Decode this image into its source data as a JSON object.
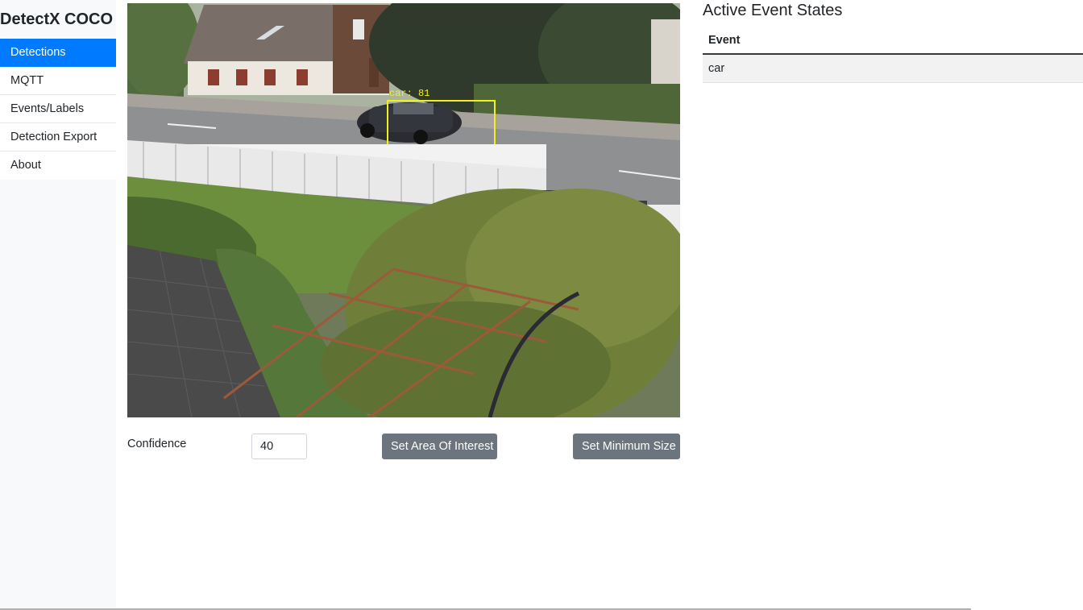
{
  "app": {
    "title": "DetectX COCO"
  },
  "sidebar": {
    "items": [
      {
        "label": "Detections",
        "active": true
      },
      {
        "label": "MQTT",
        "active": false
      },
      {
        "label": "Events/Labels",
        "active": false
      },
      {
        "label": "Detection Export",
        "active": false
      },
      {
        "label": "About",
        "active": false
      }
    ]
  },
  "camera": {
    "detection_label": "car: 81",
    "detection_color": "#f2ef1e"
  },
  "controls": {
    "confidence_label": "Confidence",
    "confidence_value": "40",
    "set_area_label": "Set Area Of Interest",
    "set_min_size_label": "Set Minimum Size"
  },
  "events": {
    "title": "Active Event States",
    "header": "Event",
    "rows": [
      "car"
    ]
  },
  "colors": {
    "accent": "#007bff",
    "button": "#6c757d",
    "sidebar_bg": "#f8f9fa"
  }
}
